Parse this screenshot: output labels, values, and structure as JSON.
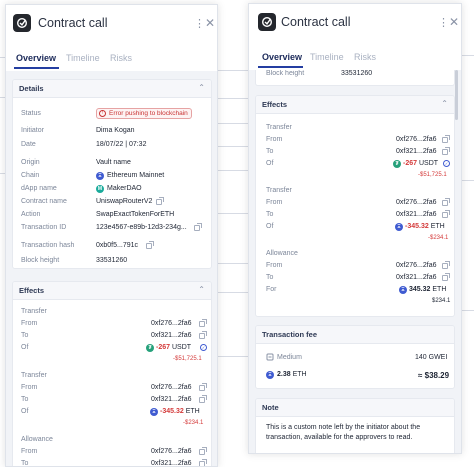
{
  "app": {
    "title": "Contract call",
    "tabs": [
      "Overview",
      "Timeline",
      "Risks"
    ]
  },
  "details": {
    "title": "Details",
    "rows": [
      {
        "label": "Status",
        "value": "Error pushing to blockchain"
      },
      {
        "label": "Initiator",
        "value": "Dima Kogan"
      },
      {
        "label": "Date",
        "value": "18/07/22 | 07:32"
      },
      {
        "label": "Origin",
        "value": "Vault name"
      },
      {
        "label": "Chain",
        "value": "Ethereum Mainnet"
      },
      {
        "label": "dApp name",
        "value": "MakerDAO"
      },
      {
        "label": "Contract name",
        "value": "UniswapRouterV2"
      },
      {
        "label": "Action",
        "value": "SwapExactTokenForETH"
      },
      {
        "label": "Transaction ID",
        "value": "123e4567-e89b-12d3-234g..."
      },
      {
        "label": "Transaction hash",
        "value": "0xb0f5...791c"
      },
      {
        "label": "Block height",
        "value": "33531260"
      }
    ]
  },
  "effects": {
    "title": "Effects",
    "labels": {
      "from": "From",
      "to": "To",
      "of": "Of",
      "for": "For"
    },
    "transfer1": {
      "title": "Transfer",
      "from": "0xf276...2fa6",
      "to": "0xf321...2fa6",
      "amount": "-267",
      "unit": "USDT",
      "fiat": "-$51,725.1"
    },
    "transfer2": {
      "title": "Transfer",
      "from": "0xf276...2fa6",
      "to": "0xf321...2fa6",
      "amount": "-345.32",
      "unit": "ETH",
      "fiat": "-$234.1"
    },
    "allowance": {
      "title": "Allowance",
      "from": "0xf276...2fa6",
      "to": "0xf321...2fa6",
      "amount": "345.32",
      "unit": "ETH",
      "fiat": "$234.1"
    }
  },
  "fee": {
    "title": "Transaction fee",
    "speed": "Medium",
    "gwei": "140 GWEI",
    "eth": "2.38",
    "eth_unit": "ETH",
    "usd": "≈ $38.29"
  },
  "note": {
    "title": "Note",
    "text": "This is a custom note left by the initiator about the transaction, available for the approvers to read."
  },
  "icons": {
    "usdt": "₮",
    "eth": "Ξ",
    "maker": "M",
    "check": "✓",
    "chevron": "⌃",
    "close": "✕",
    "kebab": "⋮",
    "error": "!"
  },
  "colors": {
    "accent": "#243ea1",
    "negative": "#d43a3a",
    "usdt": "#26a17b",
    "eth": "#3f5bd1"
  }
}
